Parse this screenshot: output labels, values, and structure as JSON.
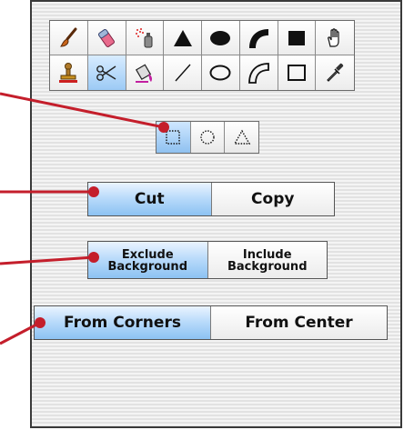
{
  "tools": {
    "row1": [
      "paintbrush-icon",
      "eraser-icon",
      "spray-can-icon",
      "triangle-filled-icon",
      "ellipse-filled-icon",
      "arc-filled-icon",
      "rectangle-filled-icon",
      "hand-icon"
    ],
    "row2": [
      "stamp-icon",
      "scissors-icon",
      "paint-bucket-icon",
      "line-icon",
      "ellipse-outline-icon",
      "arc-outline-icon",
      "rectangle-outline-icon",
      "eyedropper-icon"
    ],
    "selected": "scissors-icon"
  },
  "selection_shapes": {
    "options": [
      "rectangle-marquee-icon",
      "ellipse-marquee-icon",
      "triangle-marquee-icon"
    ],
    "selected": "rectangle-marquee-icon"
  },
  "cut_copy": {
    "cut_label": "Cut",
    "copy_label": "Copy",
    "selected": "cut"
  },
  "background_mode": {
    "exclude_line1": "Exclude",
    "exclude_line2": "Background",
    "include_line1": "Include",
    "include_line2": "Background",
    "selected": "exclude"
  },
  "origin_mode": {
    "corners_label": "From Corners",
    "center_label": "From Center",
    "selected": "corners"
  },
  "colors": {
    "callout": "#c41e2b",
    "selected_button": "#8cc2f2",
    "panel_border": "#3a3a3a"
  }
}
